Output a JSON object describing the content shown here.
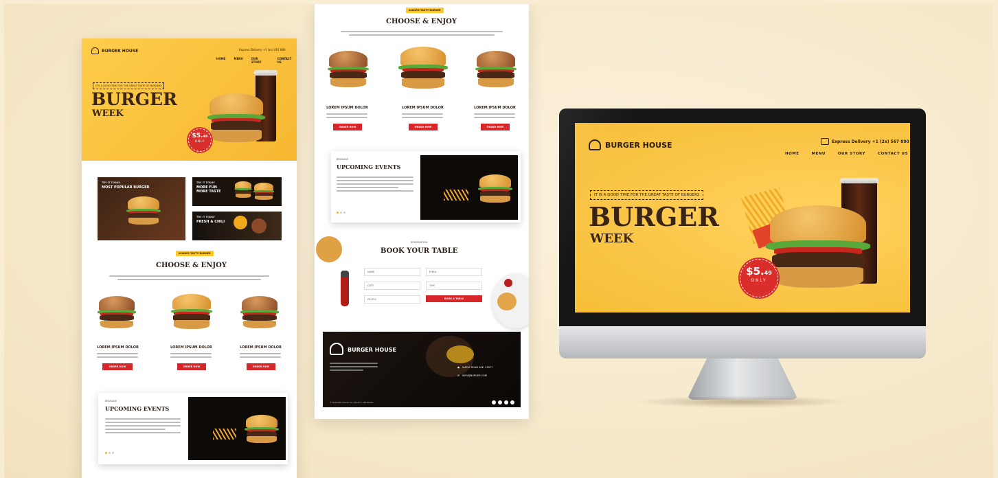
{
  "brand": {
    "name": "BURGER HOUSE",
    "colors": {
      "yellow": "#f7bd36",
      "red": "#d7262a",
      "brown": "#3a2414",
      "background": "#f8ecd2"
    }
  },
  "left_page": {
    "delivery": "Express Delivery +1 (xx) 067 890",
    "nav": [
      "HOME",
      "MENU",
      "OUR STORY",
      "CONTACT US"
    ],
    "hero_tag": "IT'S A GOOD TIME FOR THE GREAT TASTE OF BURGERS",
    "hero_title": "BURGER",
    "hero_subtitle": "WEEK",
    "price_amount": "$5.",
    "price_cents": "49",
    "price_label": "ONLY",
    "promos": [
      {
        "small": "TRY IT TODAY",
        "label": "MOST POPULAR BURGER"
      },
      {
        "small": "TRY IT TODAY",
        "label": "MORE FUN MORE TASTE"
      },
      {
        "small": "TRY IT TODAY",
        "label": "FRESH & CHILI"
      }
    ],
    "section_tag": "ALWAYS TASTY BURGER",
    "section_title": "CHOOSE & ENJOY",
    "items": [
      {
        "title": "LOREM IPSUM DOLOR",
        "button": "ORDER NOW"
      },
      {
        "title": "LOREM IPSUM DOLOR",
        "button": "ORDER NOW"
      },
      {
        "title": "LOREM IPSUM DOLOR",
        "button": "ORDER NOW"
      }
    ],
    "events_sub": "BRUSAGE",
    "events_title": "UPCOMING EVENTS"
  },
  "mid_page": {
    "section_tag": "ALWAYS TASTY BURGER",
    "section_title": "CHOOSE & ENJOY",
    "items": [
      {
        "title": "LOREM IPSUM DOLOR",
        "button": "ORDER NOW"
      },
      {
        "title": "LOREM IPSUM DOLOR",
        "button": "ORDER NOW"
      },
      {
        "title": "LOREM IPSUM DOLOR",
        "button": "ORDER NOW"
      }
    ],
    "events_sub": "BRUSAGE",
    "events_title": "UPCOMING EVENTS",
    "booking_sub": "RESERVATION",
    "booking_title": "BOOK YOUR TABLE",
    "form": {
      "name": "NAME",
      "email": "EMAIL",
      "date": "DATE",
      "time": "TIME",
      "people": "PEOPLE",
      "button": "BOOK A TABLE"
    },
    "footer": {
      "logo": "BURGER HOUSE",
      "address": "MAPLE ROAD AVE. 23977",
      "email": "INFO@BURGER.COM",
      "copyright": "© BURGER HOUSE ALL RIGHTS RESERVED"
    }
  },
  "monitor": {
    "logo": "BURGER HOUSE",
    "delivery": "Express Delivery +1 (2x) 567 890",
    "nav": [
      "HOME",
      "MENU",
      "OUR STORY",
      "CONTACT US"
    ],
    "hero_tag": "IT IS A GOOD TIME FOR THE GREAT TASTE OF BURGERS",
    "hero_title": "BURGER",
    "hero_subtitle": "WEEK",
    "price_amount": "$5.",
    "price_cents": "49",
    "price_label": "ONLY"
  }
}
